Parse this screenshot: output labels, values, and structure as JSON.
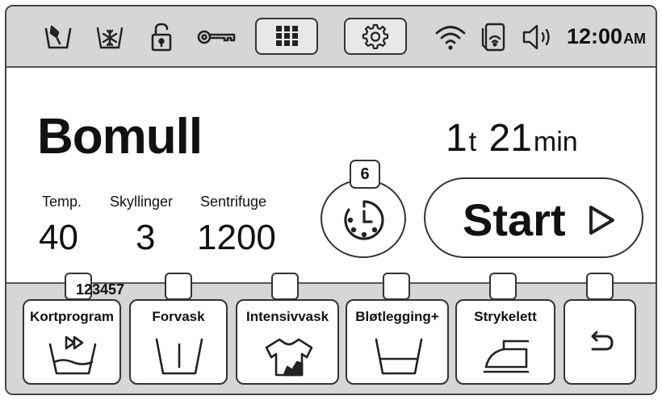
{
  "status_bar": {
    "icons": [
      "detergent-icon",
      "snowflake-tub-icon",
      "unlocked-padlock-icon",
      "key-icon",
      "wifi-icon",
      "remote-phone-icon",
      "speaker-icon"
    ],
    "clock_time": "12:00",
    "clock_ampm": "AM"
  },
  "program": {
    "name": "Bomull",
    "duration_hours": "1",
    "duration_hours_unit": "t",
    "duration_minutes": "21",
    "duration_minutes_unit": "min"
  },
  "params": {
    "temp_label": "Temp.",
    "temp_value": "40",
    "rinses_label": "Skyllinger",
    "rinses_value": "3",
    "spin_label": "Sentrifuge",
    "spin_value": "1200"
  },
  "timer": {
    "badge": "6"
  },
  "start": {
    "label": "Start"
  },
  "options": {
    "code": "123457",
    "items": [
      {
        "label": "Kortprogram"
      },
      {
        "label": "Forvask"
      },
      {
        "label": "Intensivvask"
      },
      {
        "label": "Bløtlegging+"
      },
      {
        "label": "Strykelett"
      }
    ]
  },
  "colors": {
    "panel_gray": "#d6d6d6",
    "border": "#333333"
  }
}
